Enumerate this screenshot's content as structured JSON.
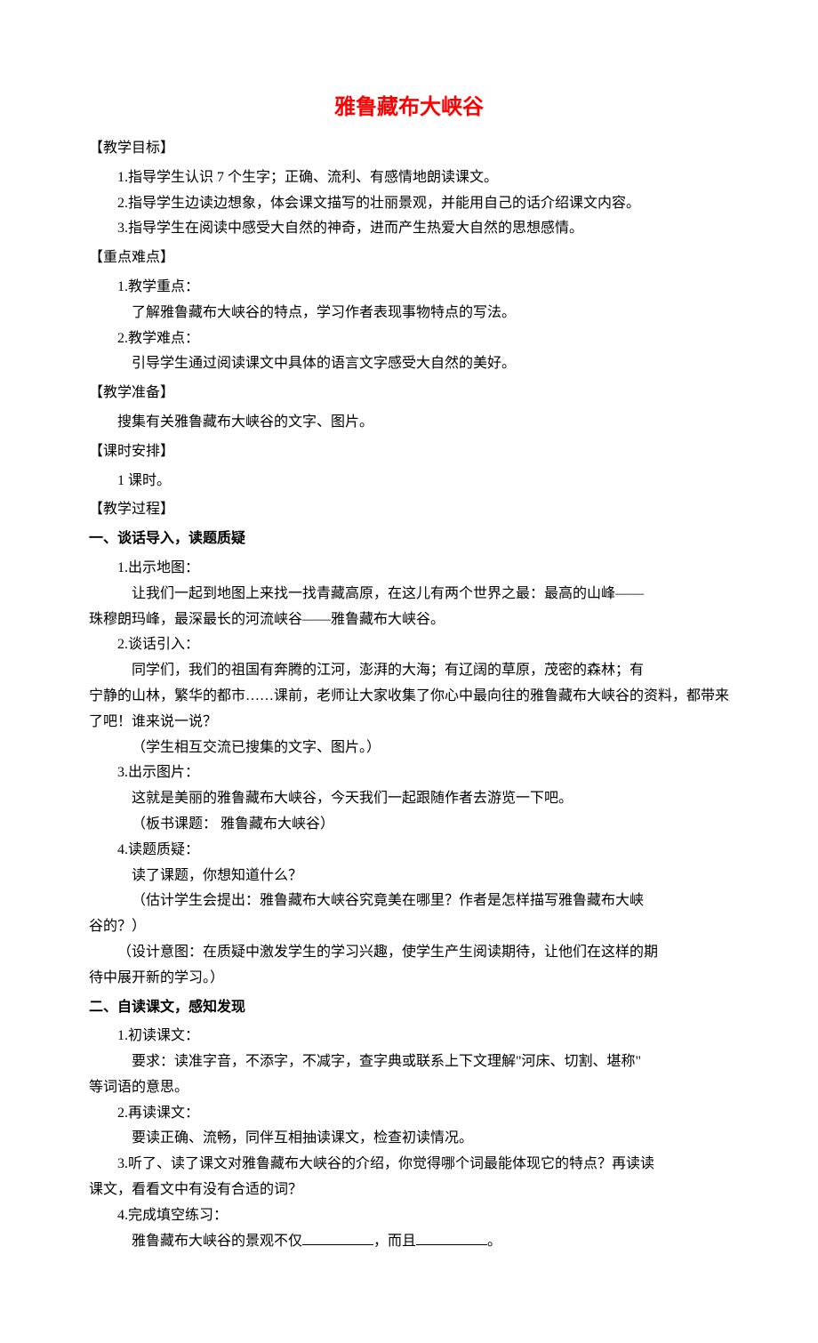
{
  "title": "雅鲁藏布大峡谷",
  "sections": {
    "goals_header": "【教学目标】",
    "goals": [
      "1.指导学生认识 7 个生字；正确、流利、有感情地朗读课文。",
      "2.指导学生边读边想象，体会课文描写的壮丽景观，并能用自己的话介绍课文内容。",
      "3.指导学生在阅读中感受大自然的神奇，进而产生热爱大自然的思想感情。"
    ],
    "keypoints_header": "【重点难点】",
    "kp1_label": "1.教学重点：",
    "kp1_body": "了解雅鲁藏布大峡谷的特点，学习作者表现事物特点的写法。",
    "kp2_label": "2.教学难点：",
    "kp2_body": "引导学生通过阅读课文中具体的语言文字感受大自然的美好。",
    "prep_header": "【教学准备】",
    "prep_body": "搜集有关雅鲁藏布大峡谷的文字、图片。",
    "time_header": "【课时安排】",
    "time_body": "1 课时。",
    "proc_header": "【教学过程】",
    "s1_header": "一、谈话导入，读题质疑",
    "s1_1_label": "1.出示地图：",
    "s1_1_body_a": "让我们一起到地图上来找一找青藏高原，在这儿有两个世界之最：最高的山峰——",
    "s1_1_body_b": "珠穆朗玛峰，最深最长的河流峡谷——雅鲁藏布大峡谷。",
    "s1_2_label": "2.谈话引入：",
    "s1_2_body_a": "同学们，我们的祖国有奔腾的江河，澎湃的大海；有辽阔的草原，茂密的森林；有",
    "s1_2_body_b": "宁静的山林，繁华的都市……课前，老师让大家收集了你心中最向往的雅鲁藏布大峡谷的资料，都带来了吧！谁来说一说？",
    "s1_2_note": "（学生相互交流已搜集的文字、图片。）",
    "s1_3_label": "3.出示图片：",
    "s1_3_body": "这就是美丽的雅鲁藏布大峡谷，今天我们一起跟随作者去游览一下吧。",
    "s1_3_note": "（板书课题：  雅鲁藏布大峡谷）",
    "s1_4_label": "4.读题质疑：",
    "s1_4_q": "读了课题，你想知道什么？",
    "s1_4_est_a": "（估计学生会提出：雅鲁藏布大峡谷究竟美在哪里？作者是怎样描写雅鲁藏布大峡",
    "s1_4_est_b": "谷的？）",
    "s1_4_design_a": "（设计意图：在质疑中激发学生的学习兴趣，使学生产生阅读期待，让他们在这样的期",
    "s1_4_design_b": "待中展开新的学习。）",
    "s2_header": "二、自读课文，感知发现",
    "s2_1_label": "1.初读课文：",
    "s2_1_body_a": "要求：读准字音，不添字，不减字，查字典或联系上下文理解\"河床、切割、堪称\"",
    "s2_1_body_b": "等词语的意思。",
    "s2_2_label": "2.再读课文：",
    "s2_2_body": "要读正确、流畅，同伴互相抽读课文，检查初读情况。",
    "s2_3_body_a": "3.听了、读了课文对雅鲁藏布大峡谷的介绍，你觉得哪个词最能体现它的特点？再读读",
    "s2_3_body_b": "课文，看看文中有没有合适的词？",
    "s2_4_label": "4.完成填空练习：",
    "s2_4_pre": "雅鲁藏布大峡谷的景观不仅",
    "s2_4_mid": "，而且",
    "s2_4_end": "。"
  }
}
